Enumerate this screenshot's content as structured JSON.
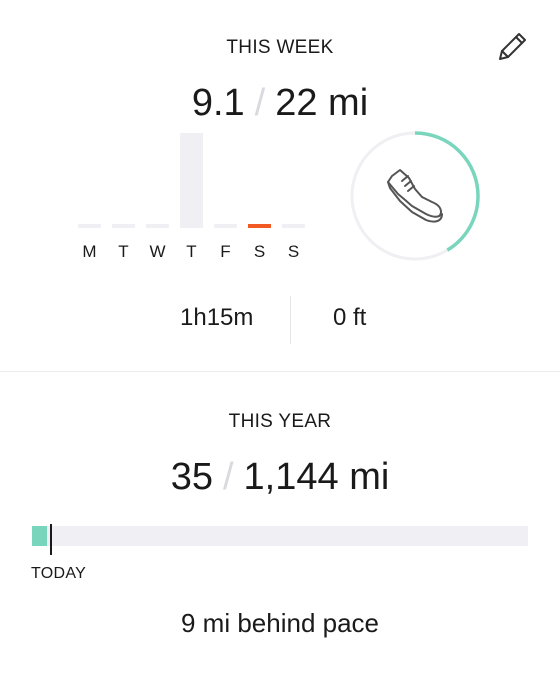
{
  "this_week": {
    "title": "THIS WEEK",
    "distance": "9.1",
    "separator": "/",
    "goal": "22 mi",
    "goal_progress": 0.414,
    "days": [
      {
        "label": "M",
        "value": 0,
        "active": false
      },
      {
        "label": "T",
        "value": 0,
        "active": false
      },
      {
        "label": "W",
        "value": 0,
        "active": false
      },
      {
        "label": "T",
        "value": 9.1,
        "active": false
      },
      {
        "label": "F",
        "value": 0,
        "active": false
      },
      {
        "label": "S",
        "value": 0,
        "active": true
      },
      {
        "label": "S",
        "value": 0,
        "active": false
      }
    ],
    "time": "1h15m",
    "elevation": "0 ft"
  },
  "this_year": {
    "title": "THIS YEAR",
    "distance": "35",
    "separator": "/",
    "goal": "1,144 mi",
    "progress": 0.031,
    "today_progress": 0.038,
    "today_label": "TODAY",
    "pace_text": "9 mi behind pace"
  },
  "colors": {
    "accent": "#79d6bc",
    "today_bar": "#f15a24",
    "track": "#efeff4"
  },
  "icons": {
    "edit": "pencil-icon",
    "activity": "shoe-icon"
  }
}
